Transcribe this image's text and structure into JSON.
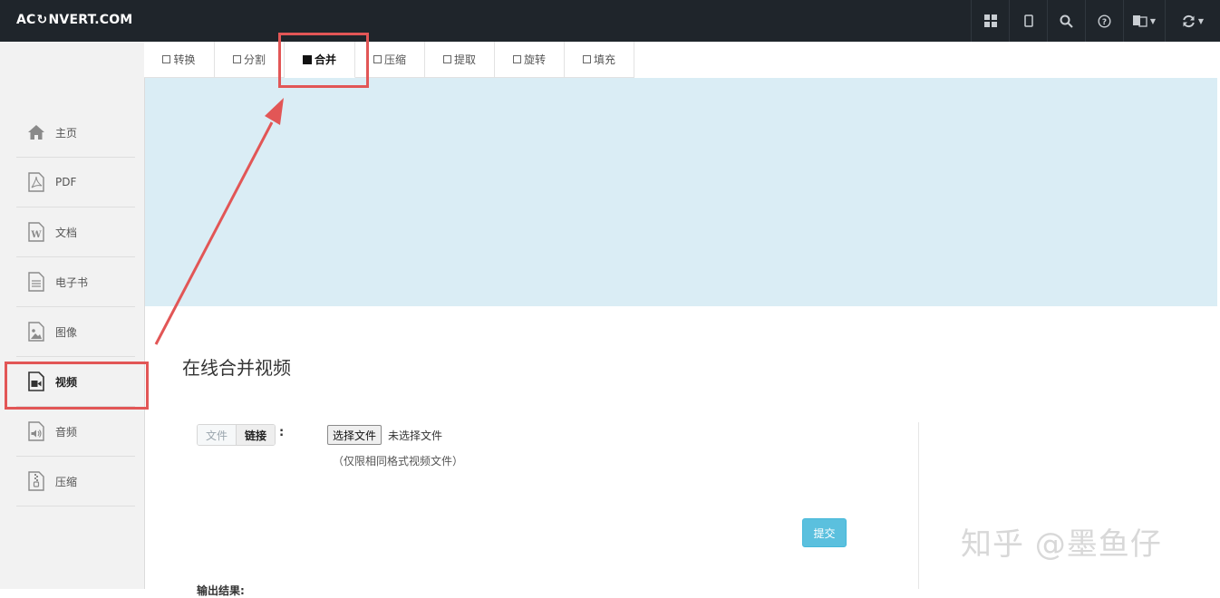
{
  "header": {
    "logo_text": "ACONVERT.COM",
    "icons": [
      "grid-icon",
      "mobile-icon",
      "search-icon",
      "help-icon",
      "language-icon",
      "refresh-icon"
    ]
  },
  "sidebar": {
    "items": [
      {
        "label": "主页",
        "icon": "home-icon"
      },
      {
        "label": "PDF",
        "icon": "pdf-icon"
      },
      {
        "label": "文档",
        "icon": "document-icon"
      },
      {
        "label": "电子书",
        "icon": "ebook-icon"
      },
      {
        "label": "图像",
        "icon": "image-icon"
      },
      {
        "label": "视频",
        "icon": "video-icon",
        "active": true
      },
      {
        "label": "音频",
        "icon": "audio-icon"
      },
      {
        "label": "压缩",
        "icon": "archive-icon"
      }
    ]
  },
  "tabs": [
    {
      "label": "转换"
    },
    {
      "label": "分割"
    },
    {
      "label": "合并",
      "active": true
    },
    {
      "label": "压缩"
    },
    {
      "label": "提取"
    },
    {
      "label": "旋转"
    },
    {
      "label": "填充"
    }
  ],
  "main": {
    "title": "在线合并视频",
    "source_toggle": {
      "file": "文件",
      "link": "链接"
    },
    "colon": ":",
    "file_button": "选择文件",
    "file_status": "未选择文件",
    "file_hint": "（仅限相同格式视频文件）",
    "submit": "提交",
    "output_label": "输出结果:"
  },
  "watermark": "知乎 @墨鱼仔",
  "colors": {
    "topbar": "#1f252b",
    "banner": "#daedf5",
    "submit": "#5bc0de",
    "annotation": "#e25656"
  }
}
